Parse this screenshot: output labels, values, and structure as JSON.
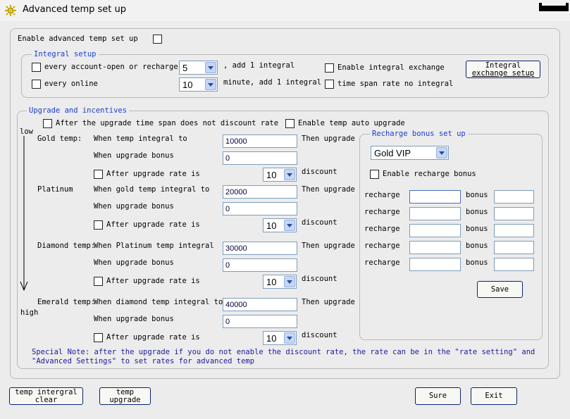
{
  "window": {
    "title": "Advanced temp set up"
  },
  "enable_advanced": {
    "label": "Enable advanced temp set up"
  },
  "integral_setup": {
    "legend": "Integral setup",
    "account_open": {
      "label": "every account-open or recharge",
      "value": "5",
      "suffix": ", add 1 integral"
    },
    "online": {
      "label": "every online",
      "value": "10",
      "suffix": "minute, add 1 integral"
    },
    "enable_exchange": "Enable integral exchange",
    "no_integral": "time span rate no integral",
    "exchange_button": [
      "Integral",
      "exchange setup"
    ]
  },
  "upgrade": {
    "legend": "Upgrade and incentives",
    "no_discount": "After the upgrade time span does not discount rate",
    "auto_upgrade": "Enable temp auto upgrade",
    "low": "low",
    "high": "high",
    "tiers": [
      {
        "name": "Gold temp:",
        "condition": "When temp integral to",
        "integral": "10000",
        "then": "Then upgrade",
        "bonus_label": "When upgrade bonus",
        "bonus": "0",
        "rate_label": "After upgrade rate is",
        "rate": "10",
        "discount": "discount"
      },
      {
        "name": "Platinum",
        "condition": "When gold temp integral to",
        "integral": "20000",
        "then": "Then upgrade",
        "bonus_label": "When upgrade bonus",
        "bonus": "0",
        "rate_label": "After upgrade rate is",
        "rate": "10",
        "discount": "discount"
      },
      {
        "name": "Diamond temp:",
        "condition": "When Platinum temp integral",
        "integral": "30000",
        "then": "Then upgrade",
        "bonus_label": "When upgrade bonus",
        "bonus": "0",
        "rate_label": "After upgrade rate is",
        "rate": "10",
        "discount": "discount"
      },
      {
        "name": "Emerald temp:",
        "condition": "When diamond temp integral to",
        "integral": "40000",
        "then": "Then upgrade",
        "bonus_label": "When upgrade bonus",
        "bonus": "0",
        "rate_label": "After upgrade rate is",
        "rate": "10",
        "discount": "discount"
      }
    ],
    "note1": "Special Note: after the upgrade if you do not enable the discount rate, the rate can be in the \"rate setting\" and",
    "note2": "\"Advanced Settings\" to set rates for advanced temp"
  },
  "recharge": {
    "legend": "Recharge bonus set up",
    "level": "Gold VIP",
    "enable": "Enable recharge bonus",
    "recharge_label": "recharge",
    "bonus_label": "bonus",
    "save": "Save"
  },
  "footer": {
    "clear": [
      "temp intergral",
      "clear"
    ],
    "upgrade": [
      "temp",
      "upgrade"
    ],
    "sure": "Sure",
    "exit": "Exit"
  }
}
